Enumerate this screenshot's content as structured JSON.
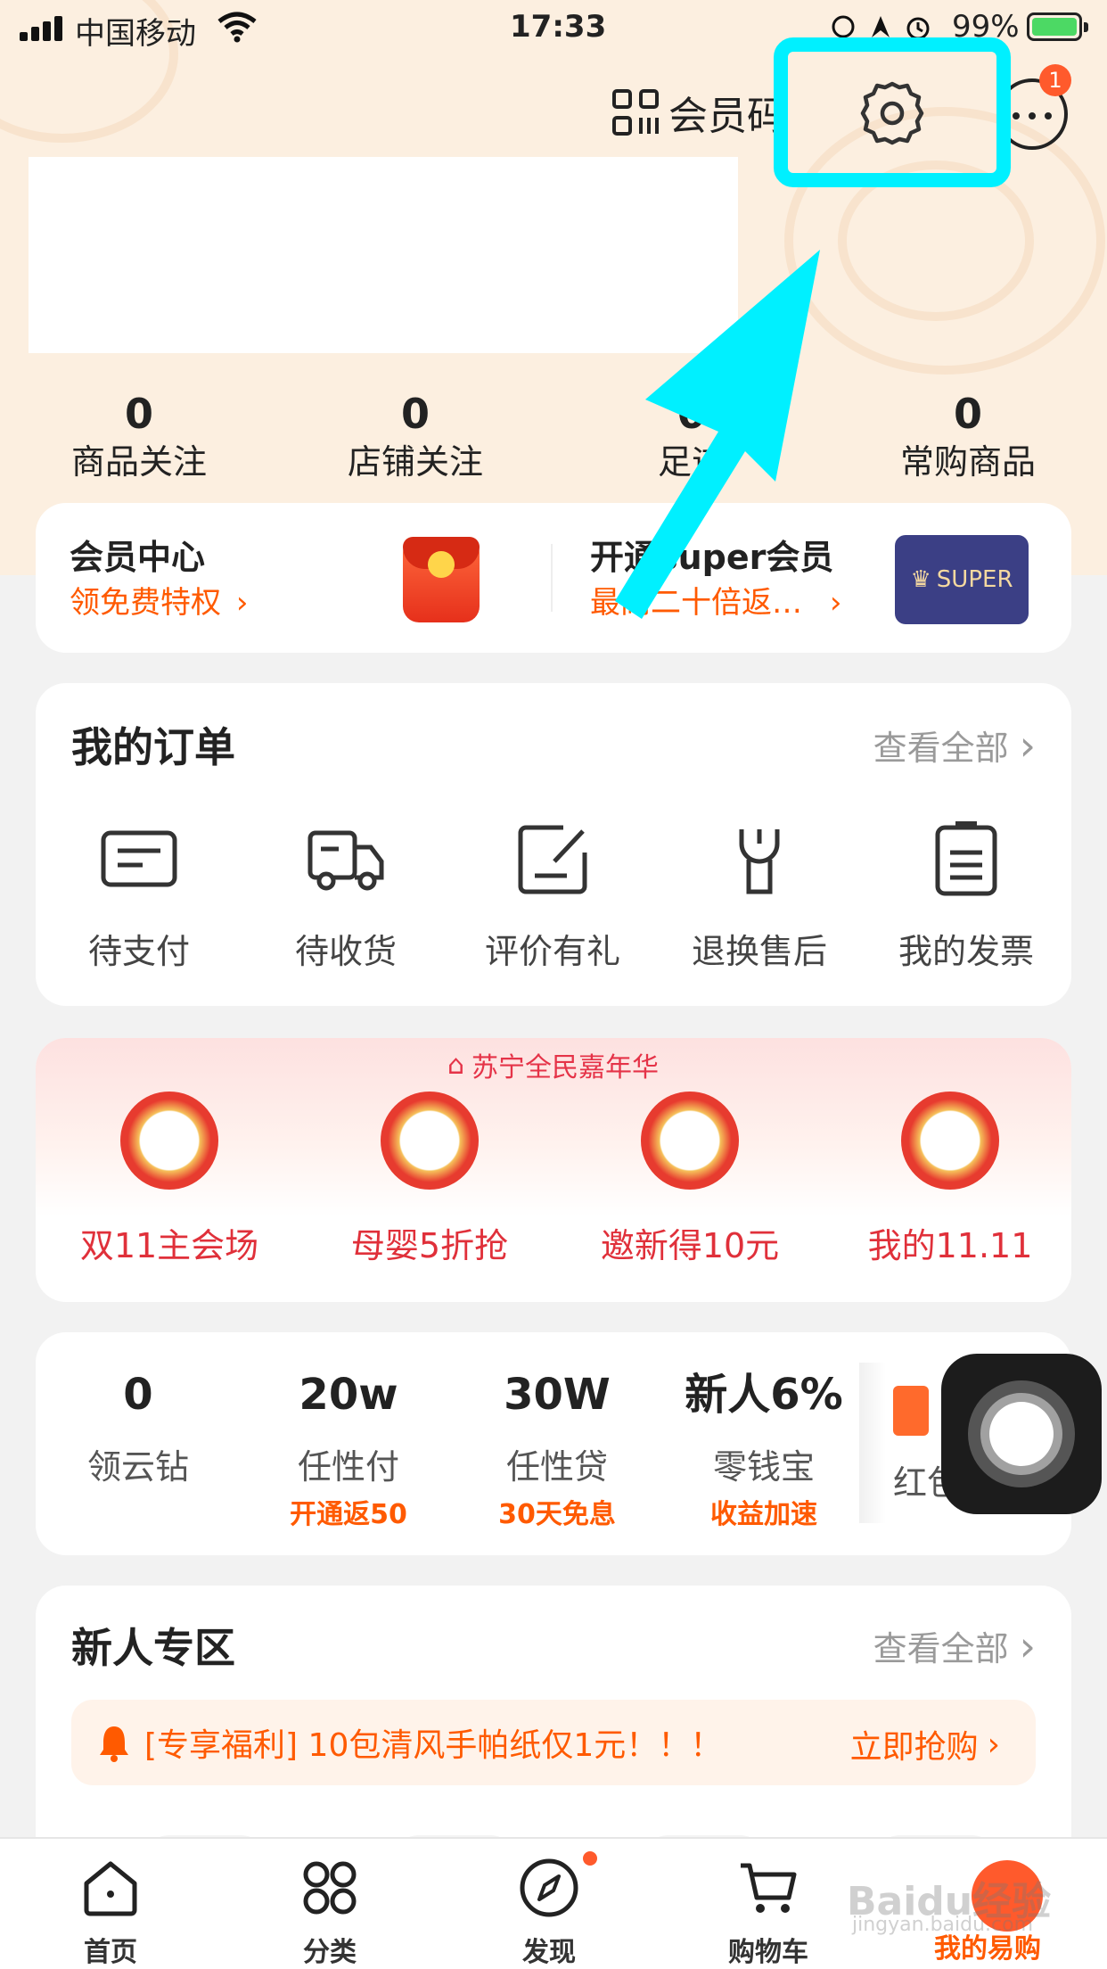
{
  "status_bar": {
    "carrier": "中国移动",
    "time": "17:33",
    "battery": "99%",
    "battery_level": 0.99
  },
  "header": {
    "member_code_label": "会员码",
    "message_badge": "1"
  },
  "stats": [
    {
      "value": "0",
      "label": "商品关注"
    },
    {
      "value": "0",
      "label": "店铺关注"
    },
    {
      "value": "0",
      "label": "足迹"
    },
    {
      "value": "0",
      "label": "常购商品"
    }
  ],
  "member_card": {
    "left_title": "会员中心",
    "left_sub": "领免费特权",
    "right_title": "开通super会员",
    "right_sub": "最高二十倍返…",
    "super_badge": "SUPER"
  },
  "orders": {
    "title": "我的订单",
    "view_all": "查看全部",
    "items": [
      {
        "label": "待支付",
        "icon": "payment-icon"
      },
      {
        "label": "待收货",
        "icon": "truck-icon"
      },
      {
        "label": "评价有礼",
        "icon": "review-icon"
      },
      {
        "label": "退换售后",
        "icon": "wrench-icon"
      },
      {
        "label": "我的发票",
        "icon": "invoice-icon"
      }
    ]
  },
  "promo": {
    "banner": "苏宁全民嘉年华",
    "items": [
      {
        "label": "双11主会场"
      },
      {
        "label": "母婴5折抢"
      },
      {
        "label": "邀新得10元"
      },
      {
        "label": "我的11.11"
      }
    ]
  },
  "finance": {
    "items": [
      {
        "value": "0",
        "label": "领云钻",
        "tag": ""
      },
      {
        "value": "20w",
        "label": "任性付",
        "tag": "开通返50"
      },
      {
        "value": "30W",
        "label": "任性贷",
        "tag": "30天免息"
      },
      {
        "value": "新人6%",
        "label": "零钱宝",
        "tag": "收益加速"
      }
    ],
    "peek_label": "红包"
  },
  "newbie": {
    "title": "新人专区",
    "view_all": "查看全部",
    "notice": "[专享福利] 10包清风手帕纸仅1元！！！",
    "cta": "立即抢购"
  },
  "tabbar": {
    "items": [
      {
        "label": "首页",
        "icon": "home-icon"
      },
      {
        "label": "分类",
        "icon": "category-icon"
      },
      {
        "label": "发现",
        "icon": "compass-icon"
      },
      {
        "label": "购物车",
        "icon": "cart-icon"
      },
      {
        "label": "我的易购",
        "icon": "profile-icon"
      }
    ]
  },
  "watermark": {
    "text": "Baidu经验",
    "sub": "jingyan.baidu.com"
  },
  "colors": {
    "accent": "#ff5a00",
    "highlight": "#00f0ff",
    "header_bg": "#fcefe0",
    "promo_red": "#e0303a"
  }
}
